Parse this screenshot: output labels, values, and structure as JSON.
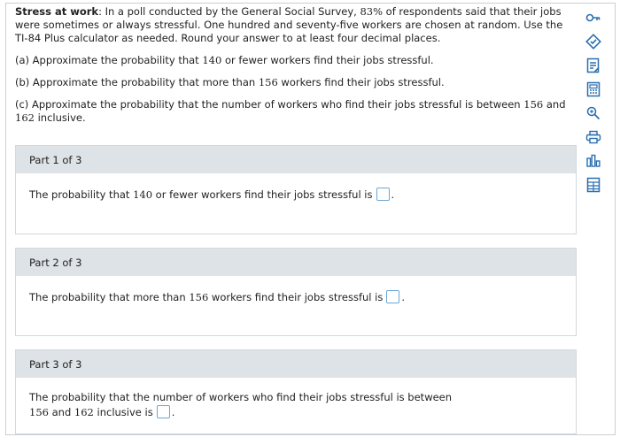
{
  "problem": {
    "title": "Stress at work",
    "intro_pre": ": In a poll conducted by the General Social Survey, ",
    "percent": "83%",
    "intro_mid": " of respondents said that their jobs were sometimes or always stressful. One hundred and seventy-five workers are chosen at random. Use the TI-84 Plus calculator as needed. Round your answer to at least four decimal places.",
    "qa_pre": "(a) Approximate the probability that ",
    "qa_num": "140",
    "qa_post": " or fewer workers find their jobs stressful.",
    "qb_pre": "(b) Approximate the probability that more than ",
    "qb_num": "156",
    "qb_post": " workers find their jobs stressful.",
    "qc_pre": "(c) Approximate the probability that the number of workers who find their jobs stressful is between ",
    "qc_num1": "156",
    "qc_mid": " and ",
    "qc_num2": "162",
    "qc_post": " inclusive."
  },
  "parts": [
    {
      "header": "Part 1 of 3",
      "text_pre": "The probability that ",
      "num": "140",
      "text_post": " or fewer workers find their jobs stressful is",
      "period": "."
    },
    {
      "header": "Part 2 of 3",
      "text_pre": "The probability that more than ",
      "num": "156",
      "text_post": " workers find their jobs stressful is",
      "period": "."
    },
    {
      "header": "Part 3 of 3",
      "line1": "The probability that the number of workers who find their jobs stressful is between",
      "num1": "156",
      "mid": " and ",
      "num2": "162",
      "post": " inclusive is",
      "period": "."
    }
  ],
  "toolbar": {
    "icons": [
      "key-icon",
      "check-answer-icon",
      "notes-icon",
      "calculator-icon",
      "data-search-icon",
      "print-icon",
      "chart-icon",
      "table-icon"
    ],
    "accent": "#2a6fb0"
  }
}
